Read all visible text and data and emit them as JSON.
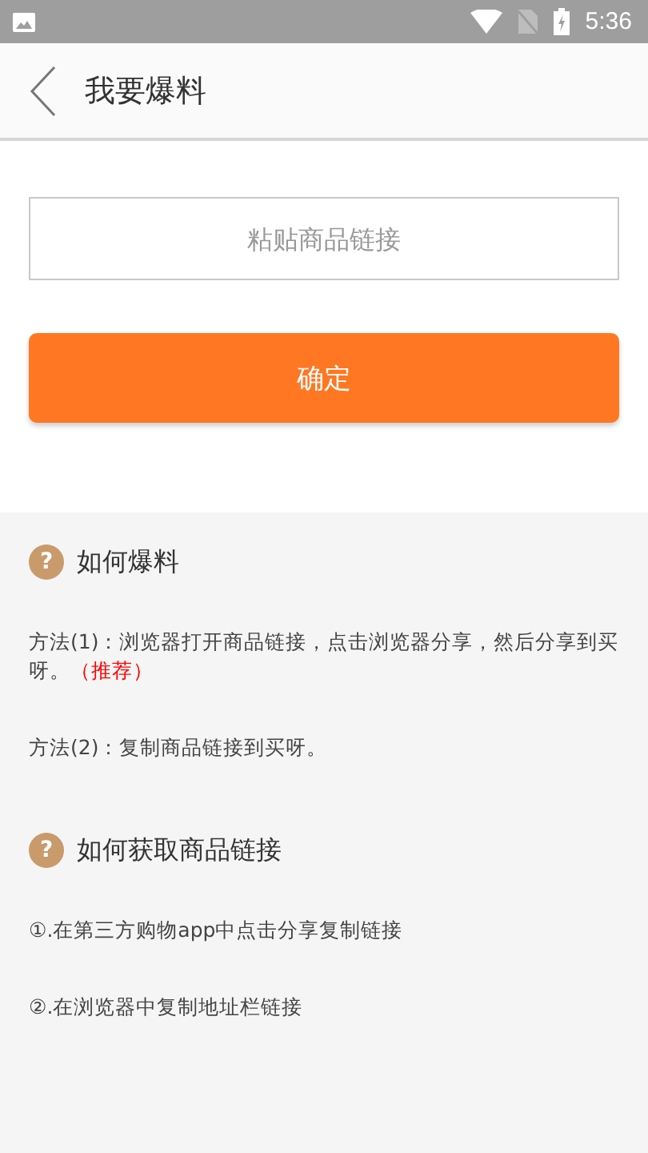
{
  "status_bar": {
    "time": "5:36"
  },
  "header": {
    "title": "我要爆料"
  },
  "link_field": {
    "placeholder": "粘贴商品链接"
  },
  "confirm_button": {
    "label": "确定"
  },
  "sections": [
    {
      "icon": "?",
      "title": "如何爆料",
      "items": [
        {
          "text": "方法(1)：浏览器打开商品链接，点击浏览器分享，然后分享到买呀。",
          "note": "（推荐）"
        },
        {
          "text": "方法(2)：复制商品链接到买呀。"
        }
      ]
    },
    {
      "icon": "?",
      "title": "如何获取商品链接",
      "items": [
        {
          "text": "①.在第三方购物app中点击分享复制链接"
        },
        {
          "text": "②.在浏览器中复制地址栏链接"
        }
      ]
    }
  ]
}
